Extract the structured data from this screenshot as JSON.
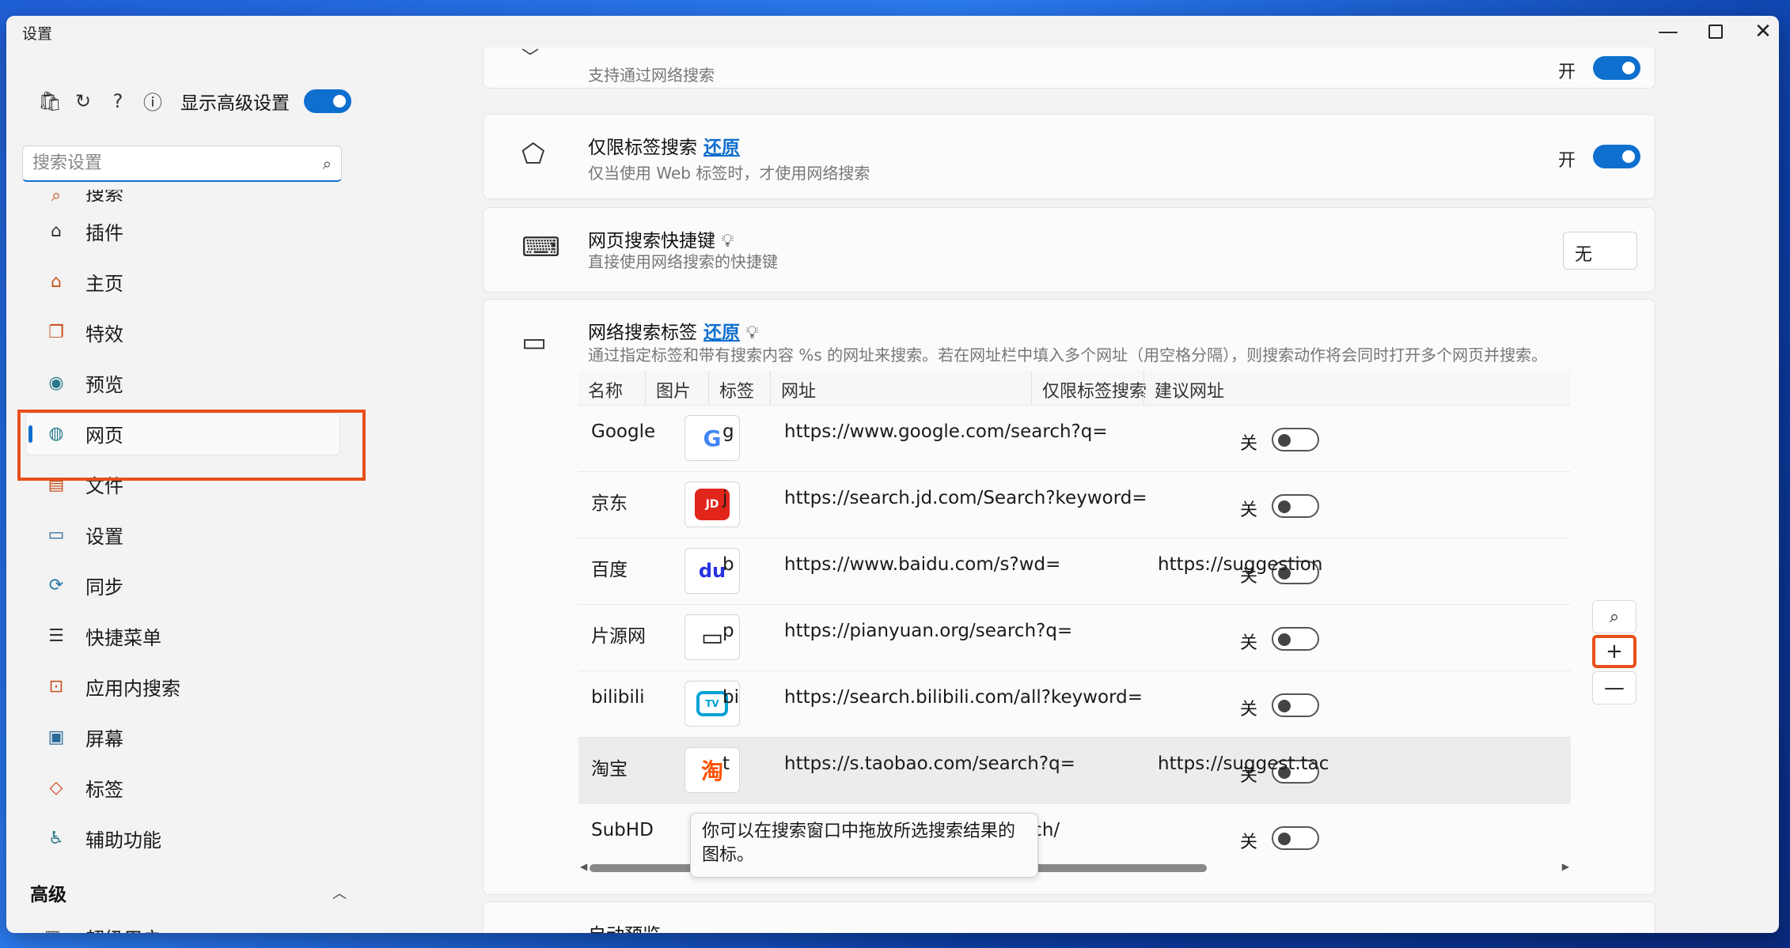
{
  "window": {
    "title": "设置"
  },
  "sidebar": {
    "show_advanced_label": "显示高级设置",
    "search_placeholder": "搜索设置",
    "items": [
      {
        "label": "搜索",
        "icon": "search-icon"
      },
      {
        "label": "插件",
        "icon": "bag-icon"
      },
      {
        "label": "主页",
        "icon": "home-icon"
      },
      {
        "label": "特效",
        "icon": "effects-icon"
      },
      {
        "label": "预览",
        "icon": "eye-icon"
      },
      {
        "label": "网页",
        "icon": "globe-icon"
      },
      {
        "label": "文件",
        "icon": "file-icon"
      },
      {
        "label": "设置",
        "icon": "laptop-icon"
      },
      {
        "label": "同步",
        "icon": "sync-icon"
      },
      {
        "label": "快捷菜单",
        "icon": "menu-icon"
      },
      {
        "label": "应用内搜索",
        "icon": "app-search-icon"
      },
      {
        "label": "屏幕",
        "icon": "screen-icon"
      },
      {
        "label": "标签",
        "icon": "tag-icon"
      },
      {
        "label": "辅助功能",
        "icon": "accessibility-icon"
      }
    ],
    "advanced_header": "高级",
    "super_user_label": "超级用户"
  },
  "cards": {
    "web_search": {
      "subtitle": "支持通过网络搜索",
      "state": "开"
    },
    "tag_only": {
      "title": "仅限标签搜索",
      "reset": "还原",
      "subtitle": "仅当使用 Web 标签时，才使用网络搜索",
      "state": "开"
    },
    "hotkey": {
      "title": "网页搜索快捷键",
      "subtitle": "直接使用网络搜索的快捷键",
      "value": "无"
    },
    "tags": {
      "title": "网络搜索标签",
      "reset": "还原",
      "subtitle": "通过指定标签和带有搜索内容 %s 的网址来搜索。若在网址栏中填入多个网址（用空格分隔），则搜索动作将会同时打开多个网页并搜索。"
    },
    "auto_preview": {
      "title": "自动预览"
    }
  },
  "table": {
    "headers": [
      "名称",
      "图片",
      "标签",
      "网址",
      "仅限标签搜索",
      "建议网址"
    ],
    "rows": [
      {
        "name": "Google",
        "logo": "G",
        "tag": "g",
        "url": "https://www.google.com/search?q=",
        "tag_only": "关",
        "suggest": ""
      },
      {
        "name": "京东",
        "logo": "JD",
        "tag": "j",
        "url": "https://search.jd.com/Search?keyword=",
        "tag_only": "关",
        "suggest": ""
      },
      {
        "name": "百度",
        "logo": "du",
        "tag": "b",
        "url": "https://www.baidu.com/s?wd=",
        "tag_only": "关",
        "suggest": "https://suggestion"
      },
      {
        "name": "片源网",
        "logo": "▭",
        "tag": "p",
        "url": "https://pianyuan.org/search?q=",
        "tag_only": "关",
        "suggest": ""
      },
      {
        "name": "bilibili",
        "logo": "TV",
        "tag": "bi",
        "url": "https://search.bilibili.com/all?keyword=",
        "tag_only": "关",
        "suggest": ""
      },
      {
        "name": "淘宝",
        "logo": "淘",
        "tag": "t",
        "url": "https://s.taobao.com/search?q=",
        "tag_only": "关",
        "suggest": "https://suggest.tac"
      },
      {
        "name": "SubHD",
        "logo": "",
        "tag": "",
        "url": "earch/",
        "tag_only": "关",
        "suggest": ""
      }
    ]
  },
  "tooltip": {
    "text": "你可以在搜索窗口中拖放所选搜索结果的图标。"
  },
  "colors": {
    "accent": "#0f6fcf",
    "highlight": "#e8501a",
    "nav_icon": "#c7501c"
  }
}
